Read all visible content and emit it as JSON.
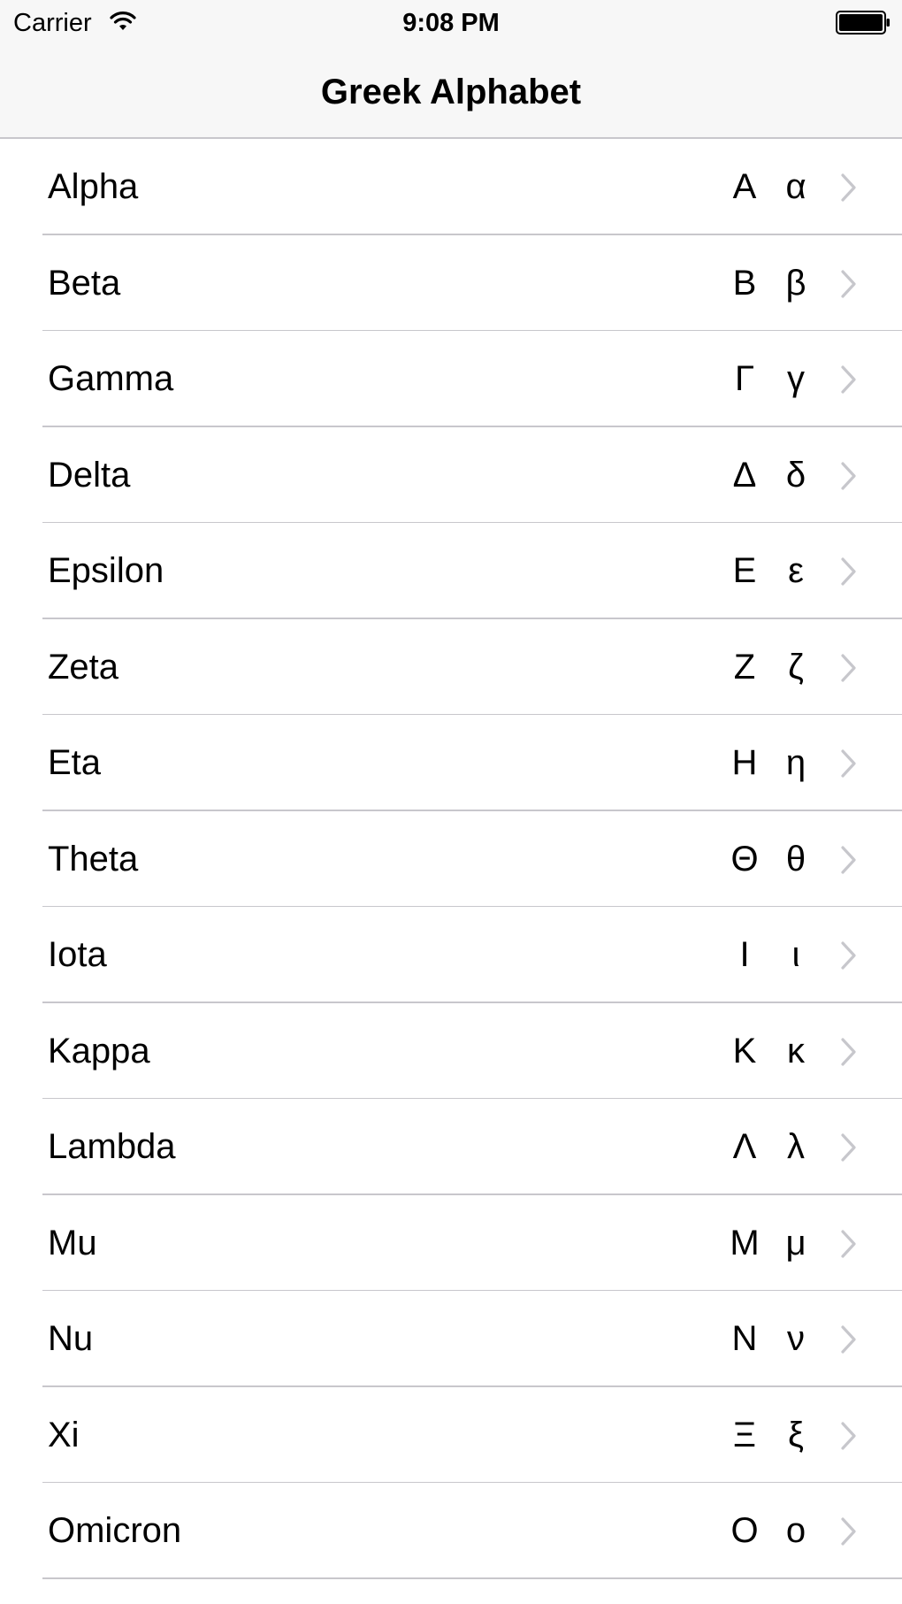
{
  "status_bar": {
    "carrier": "Carrier",
    "time": "9:08 PM",
    "icons": [
      "wifi-icon",
      "battery-icon"
    ]
  },
  "nav_bar": {
    "title": "Greek Alphabet"
  },
  "list": {
    "items": [
      {
        "name": "Alpha",
        "upper": "Α",
        "lower": "α"
      },
      {
        "name": "Beta",
        "upper": "Β",
        "lower": "β"
      },
      {
        "name": "Gamma",
        "upper": "Γ",
        "lower": "γ"
      },
      {
        "name": "Delta",
        "upper": "Δ",
        "lower": "δ"
      },
      {
        "name": "Epsilon",
        "upper": "Ε",
        "lower": "ε"
      },
      {
        "name": "Zeta",
        "upper": "Ζ",
        "lower": "ζ"
      },
      {
        "name": "Eta",
        "upper": "Η",
        "lower": "η"
      },
      {
        "name": "Theta",
        "upper": "Θ",
        "lower": "θ"
      },
      {
        "name": "Iota",
        "upper": "Ι",
        "lower": "ι"
      },
      {
        "name": "Kappa",
        "upper": "Κ",
        "lower": "κ"
      },
      {
        "name": "Lambda",
        "upper": "Λ",
        "lower": "λ"
      },
      {
        "name": "Mu",
        "upper": "Μ",
        "lower": "μ"
      },
      {
        "name": "Nu",
        "upper": "Ν",
        "lower": "ν"
      },
      {
        "name": "Xi",
        "upper": "Ξ",
        "lower": "ξ"
      },
      {
        "name": "Omicron",
        "upper": "Ο",
        "lower": "ο"
      }
    ],
    "accessory_icon": "chevron-right-icon"
  },
  "colors": {
    "bar_background": "#f7f7f7",
    "separator": "#c8c7cc",
    "chevron": "#c7c7cc",
    "text": "#000000"
  }
}
